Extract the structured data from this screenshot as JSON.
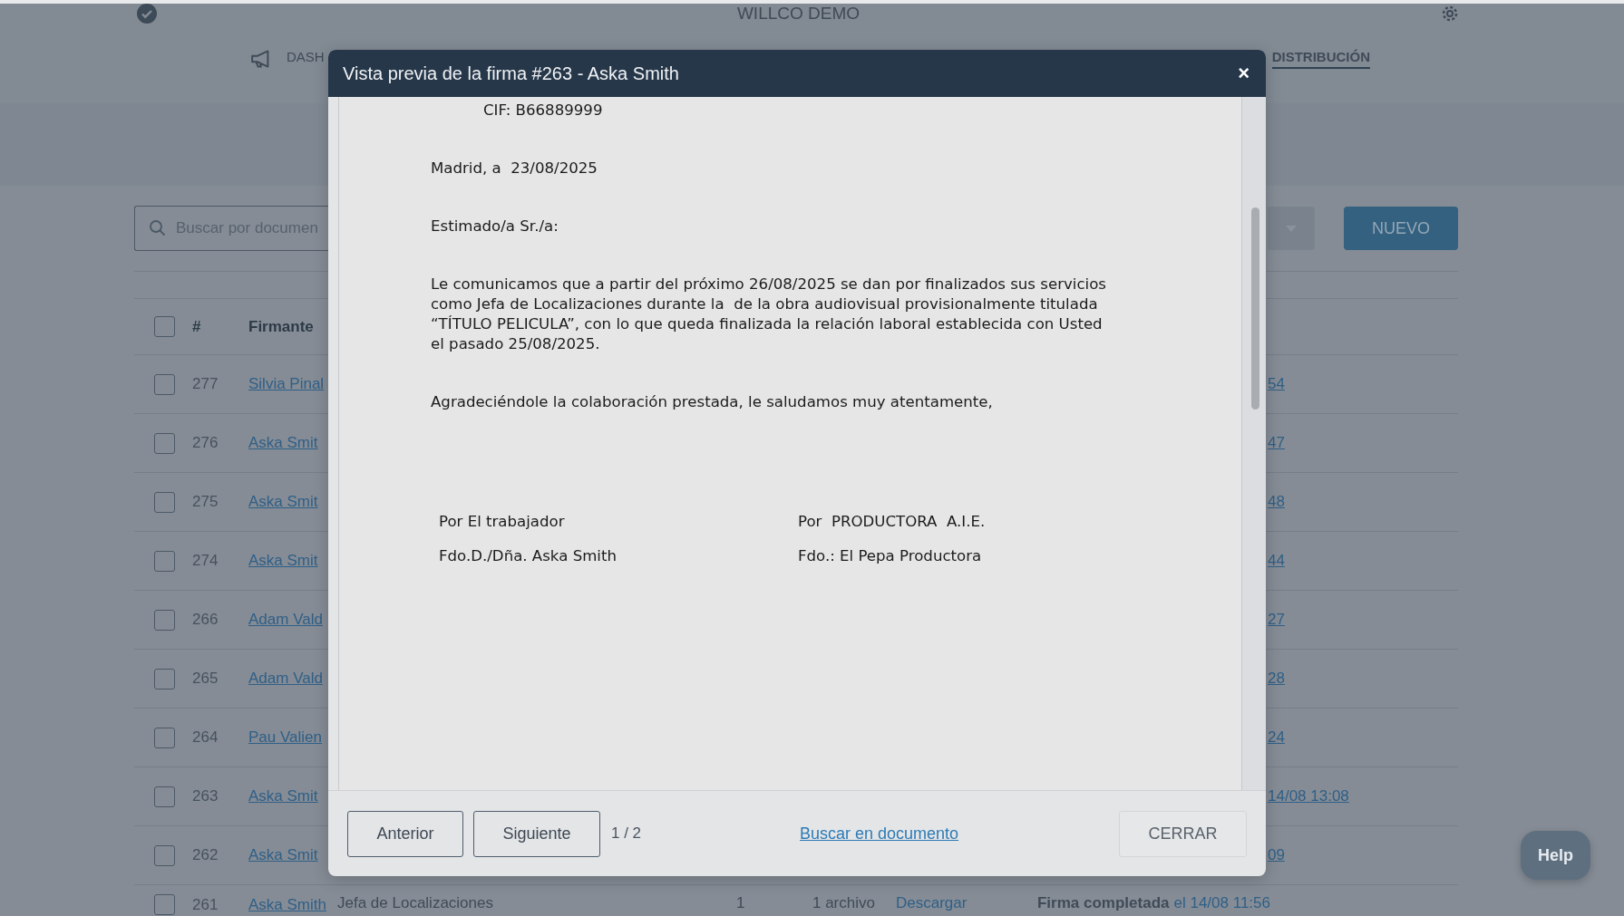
{
  "app": {
    "title": "WILLCO DEMO"
  },
  "nav": [
    {
      "label": "DASH",
      "selected": false
    },
    {
      "label": "DISTRIBUCIÓN",
      "selected": true
    }
  ],
  "search": {
    "placeholder": "Buscar por documen"
  },
  "new_button": "NUEVO",
  "table": {
    "select_all": {
      "checked": false
    },
    "columns": [
      "#",
      "Firmante"
    ],
    "rows": [
      {
        "checked": false,
        "number": "277",
        "signer": "Silvia Pinal",
        "column_end": "54"
      },
      {
        "checked": false,
        "number": "276",
        "signer": "Aska Smit",
        "column_end": "47"
      },
      {
        "checked": false,
        "number": "275",
        "signer": "Aska Smit",
        "column_end": "48"
      },
      {
        "checked": false,
        "number": "274",
        "signer": "Aska Smit",
        "column_end": "44"
      },
      {
        "checked": false,
        "number": "266",
        "signer": "Adam Vald",
        "column_end": "27"
      },
      {
        "checked": false,
        "number": "265",
        "signer": "Adam Vald",
        "column_end": "28"
      },
      {
        "checked": false,
        "number": "264",
        "signer": "Pau Valien",
        "column_end": "24"
      },
      {
        "checked": false,
        "number": "263",
        "signer": "Aska Smit",
        "column_end": "14/08 13:08"
      },
      {
        "checked": false,
        "number": "262",
        "signer": "Aska Smit",
        "column_end": "09"
      }
    ],
    "last_row": {
      "checked": false,
      "number": "261",
      "signer": "Aska Smith",
      "role": "Jefa de Localizaciones",
      "count": "1",
      "files": "1 archivo",
      "download": "Descargar",
      "status": "Firma completada",
      "date": "el 14/08 11:56"
    }
  },
  "modal": {
    "title": "Vista previa de la firma #263 - Aska Smith",
    "close": "×",
    "document": {
      "cif": "CIF: B66889999",
      "place_date": "Madrid, a  23/08/2025",
      "greeting": "Estimado/a Sr./a:",
      "body": "Le comunicamos que a partir del próximo 26/08/2025 se dan por finalizados sus servicios\ncomo Jefa de Localizaciones durante la  de la obra audiovisual provisionalmente titulada\n“TÍTULO PELICULA”, con lo que queda finalizada la relación laboral establecida con Usted\nel pasado 25/08/2025.",
      "closing": "Agradeciéndole la colaboración prestada, le saludamos muy atentamente,",
      "signatures": [
        [
          "Por El trabajador",
          "Por  PRODUCTORA  A.I.E."
        ],
        [
          "Fdo.D./Dña. Aska Smith",
          "Fdo.: El Pepa Productora"
        ]
      ]
    },
    "footer": {
      "previous": "Anterior",
      "next": "Siguiente",
      "page": "1 / 2",
      "search_link": "Buscar en documento",
      "close_button": "CERRAR"
    }
  },
  "help": "Help"
}
